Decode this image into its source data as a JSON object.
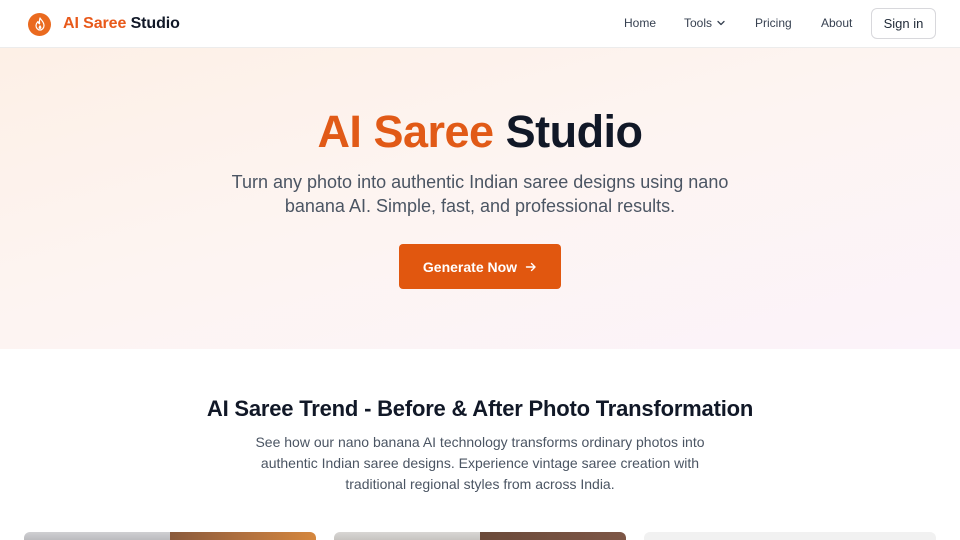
{
  "nav": {
    "brand_accent": "AI Saree",
    "brand_rest": "Studio",
    "logo_icon": "flame-icon",
    "links": [
      "Home",
      "Tools",
      "Pricing",
      "About"
    ],
    "tools_icon": "chevron-down-icon",
    "signin_label": "Sign in"
  },
  "hero": {
    "title_accent": "AI Saree",
    "title_rest": "Studio",
    "subtitle": "Turn any photo into authentic Indian saree designs using nano banana AI. Simple, fast, and professional results.",
    "cta_label": "Generate Now",
    "cta_icon": "arrow-right-icon"
  },
  "section": {
    "title": "AI Saree Trend - Before & After Photo Transformation",
    "description": "See how our nano banana AI technology transforms ordinary photos into authentic Indian saree designs. Experience vintage saree creation with traditional regional styles from across India."
  },
  "colors": {
    "accent": "#e1570f",
    "brand_orange": "#ea6a1f",
    "text_dark": "#111827",
    "text_muted": "#4b5563"
  }
}
